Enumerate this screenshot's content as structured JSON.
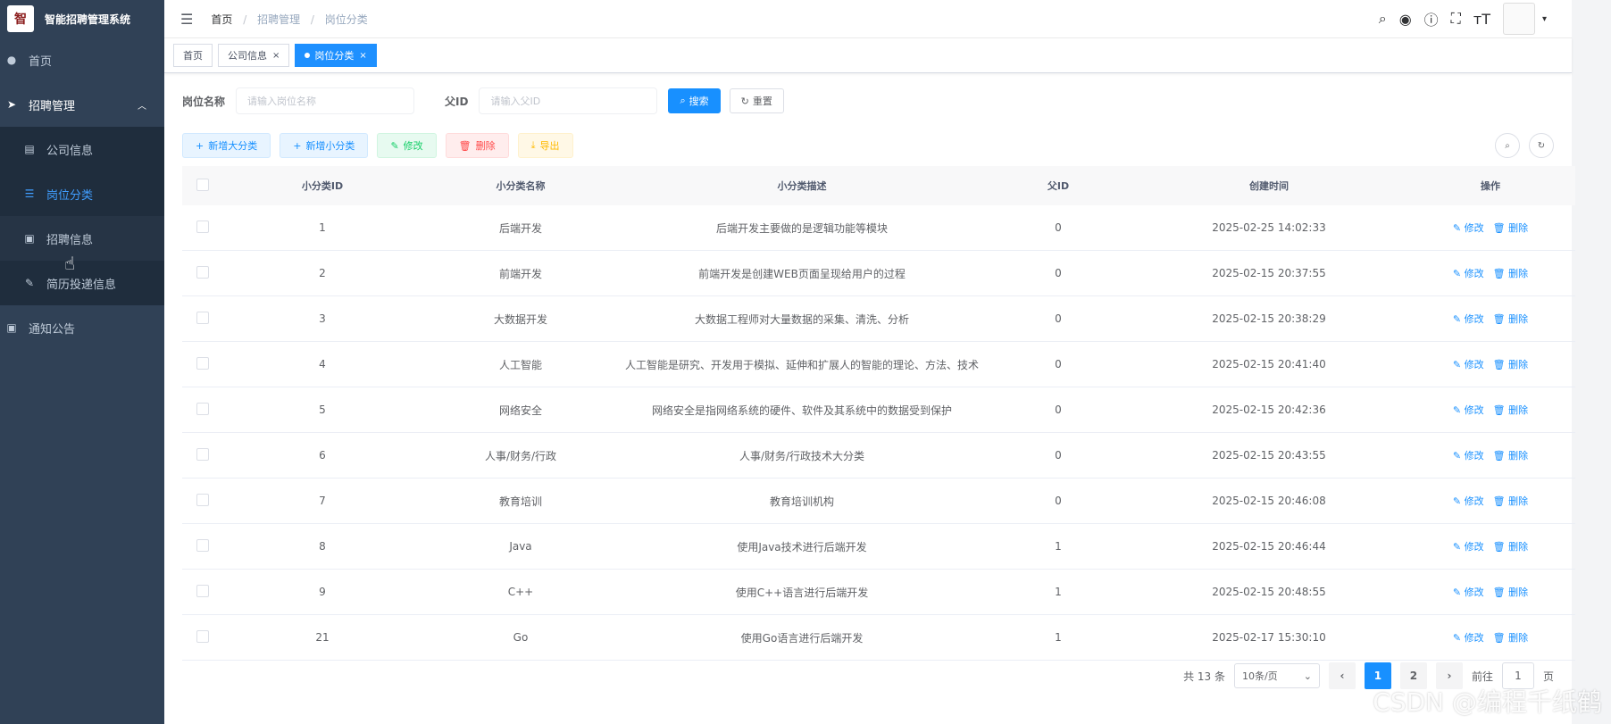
{
  "app": {
    "title": "智能招聘管理系统",
    "logo_glyph": "智"
  },
  "sidebar": {
    "items": [
      {
        "label": "首页",
        "icon": "dashboard-icon"
      },
      {
        "label": "招聘管理",
        "icon": "send-icon",
        "expanded": true
      },
      {
        "label": "通知公告",
        "icon": "message-icon"
      }
    ],
    "sub_items": [
      {
        "label": "公司信息",
        "icon": "document-icon"
      },
      {
        "label": "岗位分类",
        "icon": "list-icon",
        "active": true
      },
      {
        "label": "招聘信息",
        "icon": "message-icon"
      },
      {
        "label": "简历投递信息",
        "icon": "edit-icon"
      }
    ]
  },
  "breadcrumb": [
    "首页",
    "招聘管理",
    "岗位分类"
  ],
  "tags": [
    {
      "label": "首页"
    },
    {
      "label": "公司信息"
    },
    {
      "label": "岗位分类",
      "active": true
    }
  ],
  "search": {
    "name_label": "岗位名称",
    "name_placeholder": "请输入岗位名称",
    "parent_label": "父ID",
    "parent_placeholder": "请输入父ID",
    "search_btn": "搜索",
    "reset_btn": "重置"
  },
  "toolbar": {
    "add_big": "新增大分类",
    "add_small": "新增小分类",
    "edit": "修改",
    "delete": "删除",
    "export": "导出"
  },
  "table": {
    "columns": [
      "小分类ID",
      "小分类名称",
      "小分类描述",
      "父ID",
      "创建时间",
      "操作"
    ],
    "edit_label": "修改",
    "delete_label": "删除",
    "rows": [
      {
        "id": "1",
        "name": "后端开发",
        "desc": "后端开发主要做的是逻辑功能等模块",
        "pid": "0",
        "time": "2025-02-25 14:02:33"
      },
      {
        "id": "2",
        "name": "前端开发",
        "desc": "前端开发是创建WEB页面呈现给用户的过程",
        "pid": "0",
        "time": "2025-02-15 20:37:55"
      },
      {
        "id": "3",
        "name": "大数据开发",
        "desc": "大数据工程师对大量数据的采集、清洗、分析",
        "pid": "0",
        "time": "2025-02-15 20:38:29"
      },
      {
        "id": "4",
        "name": "人工智能",
        "desc": "人工智能是研究、开发用于模拟、延伸和扩展人的智能的理论、方法、技术",
        "pid": "0",
        "time": "2025-02-15 20:41:40"
      },
      {
        "id": "5",
        "name": "网络安全",
        "desc": "网络安全是指网络系统的硬件、软件及其系统中的数据受到保护",
        "pid": "0",
        "time": "2025-02-15 20:42:36"
      },
      {
        "id": "6",
        "name": "人事/财务/行政",
        "desc": "人事/财务/行政技术大分类",
        "pid": "0",
        "time": "2025-02-15 20:43:55"
      },
      {
        "id": "7",
        "name": "教育培训",
        "desc": "教育培训机构",
        "pid": "0",
        "time": "2025-02-15 20:46:08"
      },
      {
        "id": "8",
        "name": "Java",
        "desc": "使用Java技术进行后端开发",
        "pid": "1",
        "time": "2025-02-15 20:46:44"
      },
      {
        "id": "9",
        "name": "C++",
        "desc": "使用C++语言进行后端开发",
        "pid": "1",
        "time": "2025-02-15 20:48:55"
      },
      {
        "id": "21",
        "name": "Go",
        "desc": "使用Go语言进行后端开发",
        "pid": "1",
        "time": "2025-02-17 15:30:10"
      }
    ]
  },
  "pagination": {
    "total_text": "共 13 条",
    "page_size": "10条/页",
    "pages": [
      "1",
      "2"
    ],
    "current": "1",
    "goto_label": "前往",
    "goto_value": "1",
    "goto_suffix": "页"
  },
  "watermark": "CSDN @编程千纸鹤"
}
